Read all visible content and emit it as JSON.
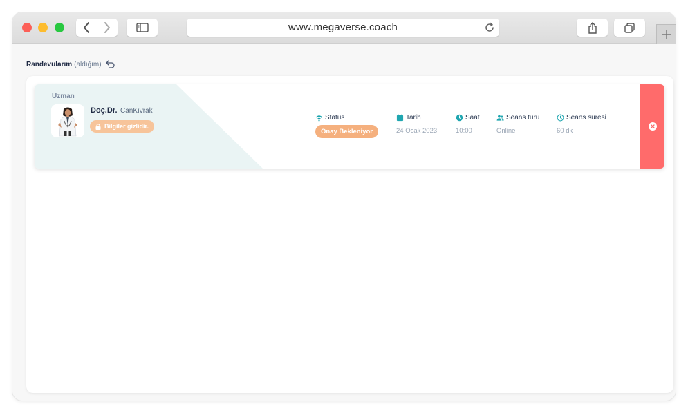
{
  "browser": {
    "url": "www.megaverse.coach",
    "icons": {
      "back": "chevron-left-icon",
      "forward": "chevron-right-icon",
      "sidebar": "sidebar-icon",
      "reload": "reload-icon",
      "share": "share-icon",
      "tabs": "tabs-icon",
      "new_tab": "plus-icon"
    }
  },
  "page": {
    "title": "Randevularım",
    "title_sub": "(aldığım)",
    "back_icon": "undo-arrow-icon"
  },
  "appointment": {
    "role_label": "Uzman",
    "doctor_title": "Doç.Dr.",
    "doctor_name": "CanKıvrak",
    "privacy_badge": "Bilgiler gizlidir.",
    "fields": {
      "status": {
        "label": "Statüs",
        "value": "Onay Bekleniyor",
        "icon": "wifi-icon"
      },
      "date": {
        "label": "Tarih",
        "value": "24 Ocak 2023",
        "icon": "calendar-icon"
      },
      "time": {
        "label": "Saat",
        "value": "10:00",
        "icon": "clock-icon"
      },
      "session_type": {
        "label": "Seans türü",
        "value": "Online",
        "icon": "users-icon"
      },
      "duration": {
        "label": "Seans süresi",
        "value": "60 dk",
        "icon": "clock-outline-icon"
      }
    },
    "cancel_icon": "close-circle-icon"
  },
  "colors": {
    "accent": "#1fa6b0",
    "status_pill": "#f5b07e",
    "badge": "#f7c49a",
    "cancel": "#ff6b6b",
    "card_tint": "#eaf4f4"
  }
}
